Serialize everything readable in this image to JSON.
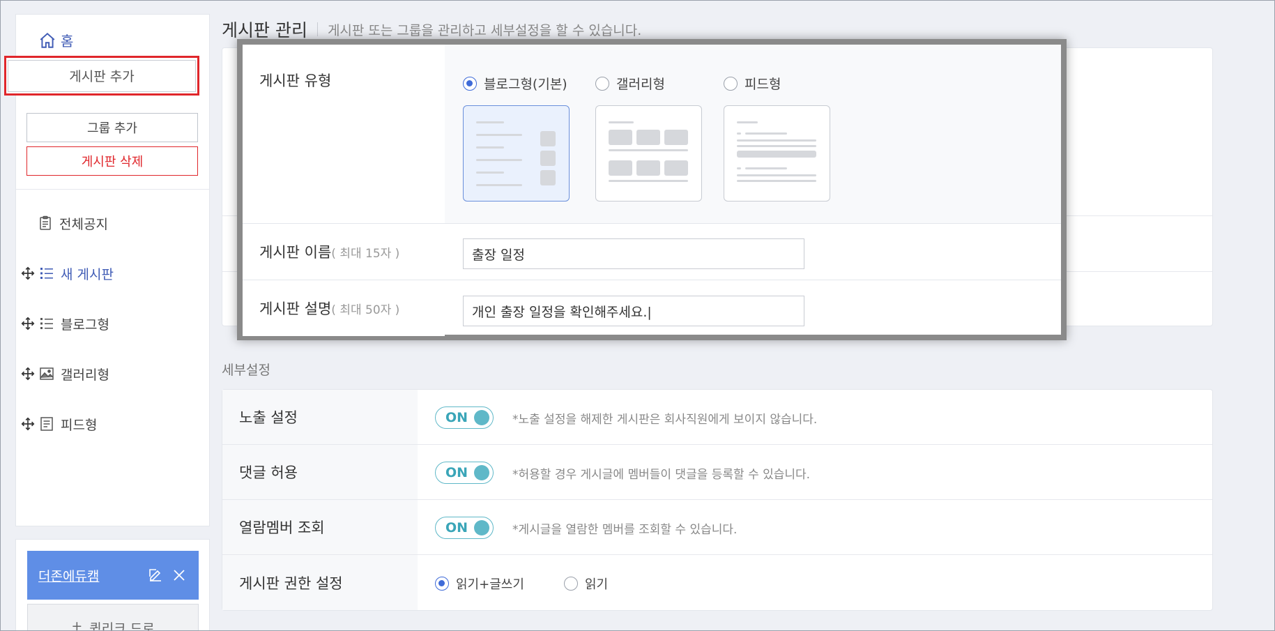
{
  "sidebar": {
    "home_label": "홈",
    "add_board_label": "게시판 추가",
    "add_group_label": "그룹 추가",
    "delete_board_label": "게시판 삭제",
    "items": [
      {
        "label": "전체공지",
        "icon": "notice-icon"
      },
      {
        "label": "새 게시판",
        "icon": "list-icon"
      },
      {
        "label": "블로그형",
        "icon": "list-icon"
      },
      {
        "label": "갤러리형",
        "icon": "image-icon"
      },
      {
        "label": "피드형",
        "icon": "document-icon"
      }
    ],
    "group": {
      "name": "더존에듀캠",
      "quick_drop_label": "퀵리크 드로"
    }
  },
  "header": {
    "title": "게시판 관리",
    "description": "게시판 또는 그룹을 관리하고 세부설정을 할 수 있습니다."
  },
  "modal": {
    "type_label": "게시판 유형",
    "types": [
      {
        "label": "블로그형(기본)",
        "checked": true
      },
      {
        "label": "갤러리형",
        "checked": false
      },
      {
        "label": "피드형",
        "checked": false
      }
    ],
    "name_label": "게시판 이름",
    "name_hint": "( 최대 15자 )",
    "name_value": "출장 일정",
    "desc_label": "게시판 설명",
    "desc_hint": "( 최대 50자 )",
    "desc_value": "개인 출장 일정을 확인해주세요.|"
  },
  "detail": {
    "section_title": "세부설정",
    "rows": [
      {
        "label": "노출 설정",
        "toggle": "ON",
        "note": "*노출 설정을 해제한 게시판은 회사직원에게 보이지 않습니다."
      },
      {
        "label": "댓글 허용",
        "toggle": "ON",
        "note": "*허용할 경우 게시글에 멤버들이 댓글을 등록할 수 있습니다."
      },
      {
        "label": "열람멤버 조회",
        "toggle": "ON",
        "note": "*게시글을 열람한 멤버를 조회할 수 있습니다."
      }
    ],
    "permission": {
      "label": "게시판 권한 설정",
      "options": [
        {
          "label": "읽기+글쓰기",
          "checked": true
        },
        {
          "label": "읽기",
          "checked": false
        }
      ]
    }
  },
  "colors": {
    "accent": "#3f5bb5",
    "danger": "#e0262b",
    "toggle": "#5fb8c8",
    "group_header": "#5f8ee6"
  }
}
